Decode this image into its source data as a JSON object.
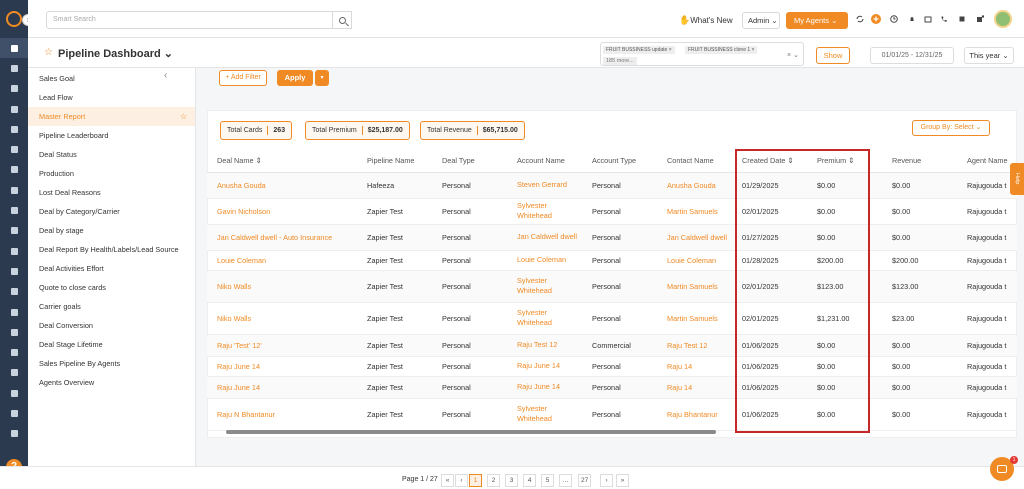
{
  "topbar": {
    "search_placeholder": "Smart Search",
    "whats_new": "What's New",
    "admin_label": "Admin",
    "my_agents_label": "My Agents"
  },
  "header": {
    "title": "Pipeline Dashboard",
    "chips": [
      "FRUIT BUSSINESS update",
      "FRUIT BUSSINESS clone 1"
    ],
    "more": "185 more...",
    "show_label": "Show",
    "date_range": "01/01/25 - 12/31/25",
    "period": "This year"
  },
  "sidebar": {
    "items": [
      "Sales Goal",
      "Lead Flow",
      "Master Report",
      "Pipeline Leaderboard",
      "Deal Status",
      "Production",
      "Lost Deal Reasons",
      "Deal by Category/Carrier",
      "Deal by stage",
      "Deal Report By Health/Labels/Lead Source",
      "Deal Activities Effort",
      "Quote to close cards",
      "Carrier goals",
      "Deal Conversion",
      "Deal Stage Lifetime",
      "Sales Pipeline By Agents",
      "Agents Overview"
    ],
    "active_index": 2
  },
  "filters": {
    "add_filter": "+ Add Filter",
    "apply": "Apply"
  },
  "stats": {
    "total_cards_label": "Total Cards",
    "total_cards": "263",
    "total_premium_label": "Total Premium",
    "total_premium": "$25,187.00",
    "total_revenue_label": "Total Revenue",
    "total_revenue": "$65,715.00",
    "group_by": "Group By: Select"
  },
  "table": {
    "columns": [
      "Deal Name ⇕",
      "Pipeline Name",
      "Deal Type",
      "Account Name",
      "Account Type",
      "Contact Name",
      "Created Date ⇕",
      "Premium ⇕",
      "Revenue",
      "Agent Name"
    ],
    "rows": [
      [
        "Anusha Gouda",
        "Hafeeza",
        "Personal",
        "Steven Gerrard",
        "Personal",
        "Anusha Gouda",
        "01/29/2025",
        "$0.00",
        "$0.00",
        "Rajugouda t"
      ],
      [
        "Gavin Nicholson",
        "Zapier Test",
        "Personal",
        "Sylvester Whitehead",
        "Personal",
        "Martin Samuels",
        "02/01/2025",
        "$0.00",
        "$0.00",
        "Rajugouda t"
      ],
      [
        "Jan Caldwell dwell - Auto Insurance",
        "Zapier Test",
        "Personal",
        "Jan Caldwell dwell",
        "Personal",
        "Jan Caldwell dwell",
        "01/27/2025",
        "$0.00",
        "$0.00",
        "Rajugouda t"
      ],
      [
        "Louie Coleman",
        "Zapier Test",
        "Personal",
        "Louie Coleman",
        "Personal",
        "Louie Coleman",
        "01/28/2025",
        "$200.00",
        "$200.00",
        "Rajugouda t"
      ],
      [
        "Niko Walls",
        "Zapier Test",
        "Personal",
        "Sylvester Whitehead",
        "Personal",
        "Martin Samuels",
        "02/01/2025",
        "$123.00",
        "$123.00",
        "Rajugouda t"
      ],
      [
        "Niko Walls",
        "Zapier Test",
        "Personal",
        "Sylvester Whitehead",
        "Personal",
        "Martin Samuels",
        "02/01/2025",
        "$1,231.00",
        "$23.00",
        "Rajugouda t"
      ],
      [
        "Raju 'Test' 12'",
        "Zapier Test",
        "Personal",
        "Raju Test 12",
        "Commercial",
        "Raju Test 12",
        "01/06/2025",
        "$0.00",
        "$0.00",
        "Rajugouda t"
      ],
      [
        "Raju June 14",
        "Zapier Test",
        "Personal",
        "Raju June 14",
        "Personal",
        "Raju 14",
        "01/06/2025",
        "$0.00",
        "$0.00",
        "Rajugouda t"
      ],
      [
        "Raju June 14",
        "Zapier Test",
        "Personal",
        "Raju June 14",
        "Personal",
        "Raju 14",
        "01/06/2025",
        "$0.00",
        "$0.00",
        "Rajugouda t"
      ],
      [
        "Raju N Bhantanur",
        "Zapier Test",
        "Personal",
        "Sylvester Whitehead",
        "Personal",
        "Raju Bhantanur",
        "01/06/2025",
        "$0.00",
        "$0.00",
        "Rajugouda t"
      ]
    ]
  },
  "pagination": {
    "info": "Page 1 / 27",
    "pages": [
      "«",
      "‹",
      "1",
      "2",
      "3",
      "4",
      "5",
      "...",
      "27",
      "›",
      "»"
    ],
    "current": "1"
  },
  "help_tab": "Help",
  "chat_badge": "1",
  "colors": {
    "accent": "#f08a24",
    "rail": "#2c3a4f",
    "highlight": "#c62828"
  }
}
